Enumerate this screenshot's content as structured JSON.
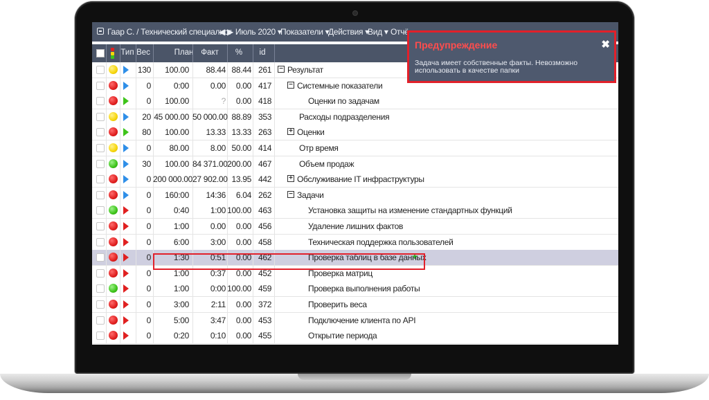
{
  "header": {
    "user": "Гаар С. / Технический специалист",
    "period_nav": "◀ ▶ Июль 2020 ▾",
    "menus": [
      "Показатели ▾",
      "Действия ▾",
      "Вид ▾",
      "Отчё"
    ]
  },
  "columns": [
    "Тип",
    "Вес",
    "План",
    "Факт",
    "%",
    "id"
  ],
  "rows": [
    {
      "status": "yellow",
      "type": "blue",
      "weight": "130",
      "plan": "100.00",
      "fact": "88.44",
      "percent": "88.44",
      "id": "261",
      "name": "Результат",
      "tree": "minus",
      "level": 0
    },
    {
      "status": "red",
      "type": "blue",
      "weight": "0",
      "plan": "0:00",
      "fact": "0.00",
      "percent": "0.00",
      "id": "417",
      "name": "Системные показатели",
      "tree": "minus",
      "level": 1
    },
    {
      "status": "red",
      "type": "green",
      "weight": "0",
      "plan": "100.00",
      "fact": "?",
      "percent": "0.00",
      "id": "418",
      "name": "Оценки по задачам",
      "tree": "",
      "level": 2
    },
    {
      "status": "yellow",
      "type": "blue",
      "weight": "20",
      "plan": "45 000.00",
      "fact": "50 000.00",
      "percent": "88.89",
      "id": "353",
      "name": "Расходы подразделения",
      "tree": "",
      "level": 1
    },
    {
      "status": "red",
      "type": "green",
      "weight": "80",
      "plan": "100.00",
      "fact": "13.33",
      "percent": "13.33",
      "id": "263",
      "name": "Оценки",
      "tree": "plus",
      "level": 1
    },
    {
      "status": "yellow",
      "type": "blue",
      "weight": "0",
      "plan": "80.00",
      "fact": "8.00",
      "percent": "50.00",
      "id": "414",
      "name": "Отр время",
      "tree": "",
      "level": 1
    },
    {
      "status": "green",
      "type": "blue",
      "weight": "30",
      "plan": "100.00",
      "fact": "84 371.00",
      "percent": "200.00",
      "id": "467",
      "name": "Объем продаж",
      "tree": "",
      "level": 1
    },
    {
      "status": "red",
      "type": "blue",
      "weight": "0",
      "plan": "200 000.00",
      "fact": "27 902.00",
      "percent": "13.95",
      "id": "442",
      "name": "Обслуживание IT инфраструктуры",
      "tree": "plus",
      "level": 1
    },
    {
      "status": "red",
      "type": "blue",
      "weight": "0",
      "plan": "160:00",
      "fact": "14:36",
      "percent": "6.04",
      "id": "262",
      "name": "Задачи",
      "tree": "minus",
      "level": 1
    },
    {
      "status": "green",
      "type": "red",
      "weight": "0",
      "plan": "0:40",
      "fact": "1:00",
      "percent": "100.00",
      "id": "463",
      "name": "Установка защиты на изменение стандартных функций",
      "tree": "",
      "level": 2
    },
    {
      "status": "red",
      "type": "red",
      "weight": "0",
      "plan": "1:00",
      "fact": "0.00",
      "percent": "0.00",
      "id": "456",
      "name": "Удаление лишних фактов",
      "tree": "",
      "level": 2
    },
    {
      "status": "red",
      "type": "red",
      "weight": "0",
      "plan": "6:00",
      "fact": "3:00",
      "percent": "0.00",
      "id": "458",
      "name": "Техническая поддержка пользователей",
      "tree": "",
      "level": 2
    },
    {
      "status": "red",
      "type": "red",
      "weight": "0",
      "plan": "1:30",
      "fact": "0:51",
      "percent": "0.00",
      "id": "462",
      "name": "Проверка таблиц в базе данных",
      "tree": "",
      "level": 2,
      "selected": true,
      "add_icon": "+"
    },
    {
      "status": "red",
      "type": "red",
      "weight": "0",
      "plan": "1:00",
      "fact": "0:37",
      "percent": "0.00",
      "id": "452",
      "name": "Проверка матриц",
      "tree": "",
      "level": 2
    },
    {
      "status": "green",
      "type": "red",
      "weight": "0",
      "plan": "1:00",
      "fact": "0:00",
      "percent": "100.00",
      "id": "459",
      "name": "Проверка выполнения работы",
      "tree": "",
      "level": 2
    },
    {
      "status": "red",
      "type": "red",
      "weight": "0",
      "plan": "3:00",
      "fact": "2:11",
      "percent": "0.00",
      "id": "372",
      "name": "Проверить веса",
      "tree": "",
      "level": 2
    },
    {
      "status": "red",
      "type": "red",
      "weight": "0",
      "plan": "5:00",
      "fact": "3:47",
      "percent": "0.00",
      "id": "453",
      "name": "Подключение клиента по API",
      "tree": "",
      "level": 2
    },
    {
      "status": "red",
      "type": "red",
      "weight": "0",
      "plan": "0:20",
      "fact": "0:10",
      "percent": "0.00",
      "id": "455",
      "name": "Открытие периода",
      "tree": "",
      "level": 2
    }
  ],
  "warning": {
    "title": "Предупреждение",
    "close_icon": "✖",
    "message": "Задача имеет собственные факты. Невозможно использовать в качестве папки"
  },
  "colors": {
    "header_bg": "#4b5568",
    "warning_title": "#ff4d4d",
    "highlight": "#e2202a",
    "selected_row": "#cfcfe0"
  }
}
